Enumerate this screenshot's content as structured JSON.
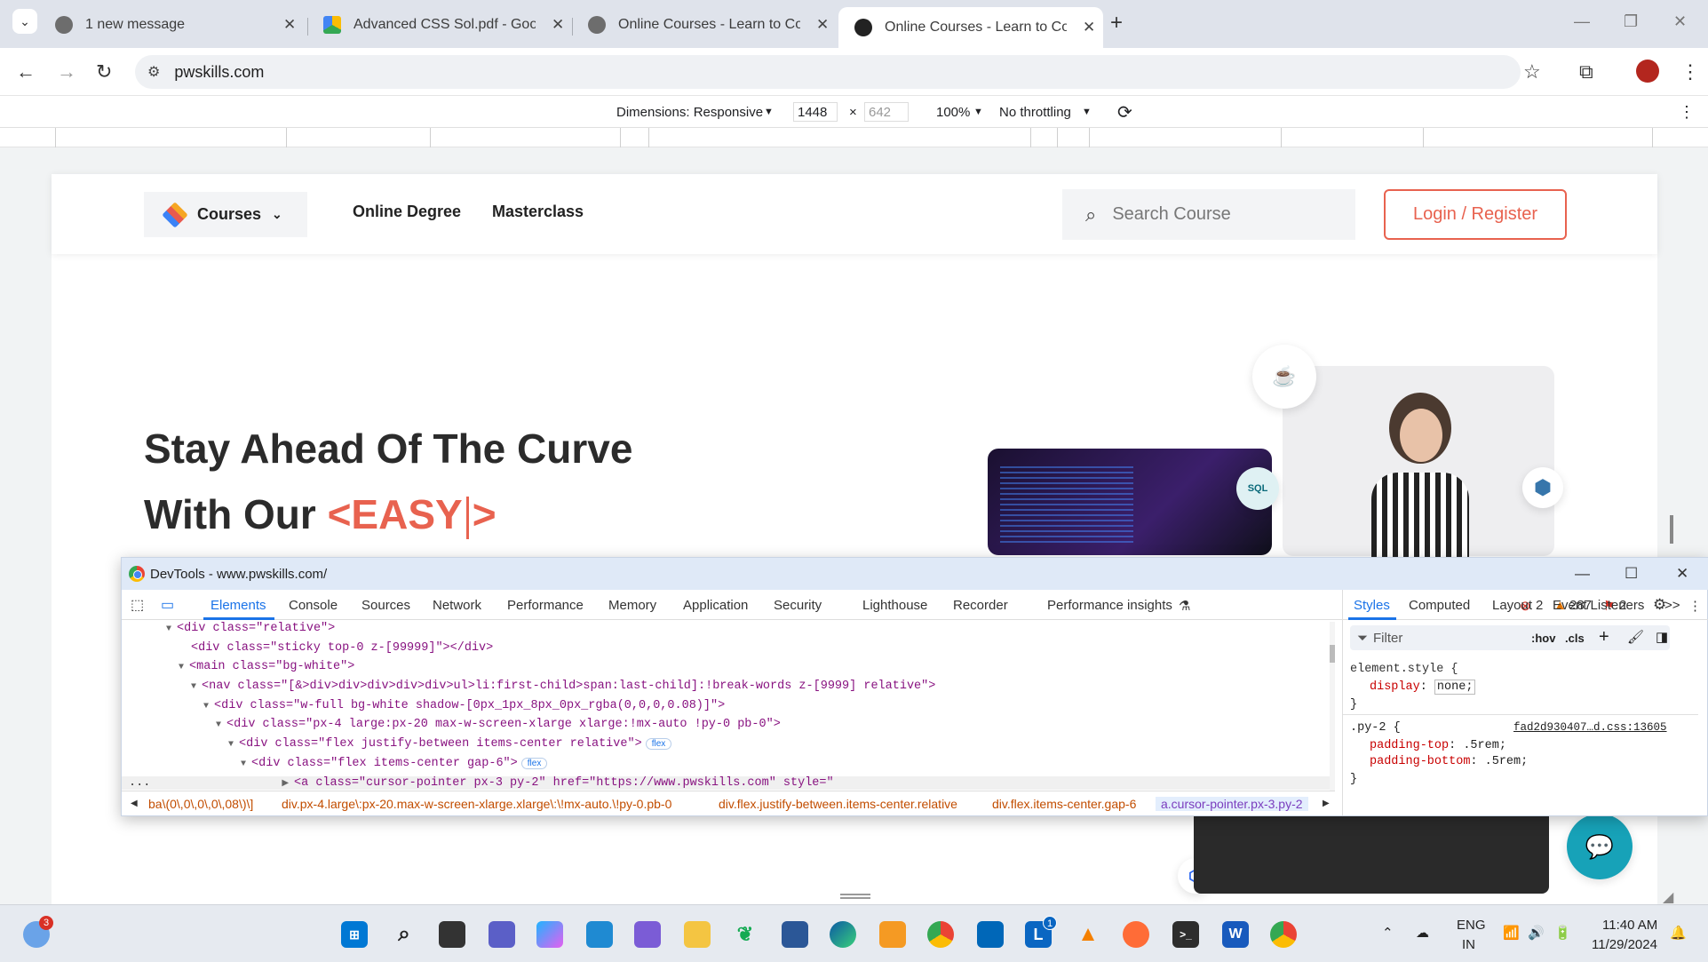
{
  "browser": {
    "tabs": [
      {
        "title": "1 new message"
      },
      {
        "title": "Advanced CSS Sol.pdf - Google"
      },
      {
        "title": "Online Courses - Learn to Code"
      },
      {
        "title": "Online Courses - Learn to Code"
      }
    ],
    "new_tab": "+",
    "url": "pwskills.com"
  },
  "device_toolbar": {
    "dimensions_label": "Dimensions: Responsive",
    "width": "1448",
    "times": "×",
    "height": "642",
    "zoom": "100%",
    "throttling": "No throttling"
  },
  "site": {
    "nav": {
      "courses": "Courses",
      "online_degree": "Online Degree",
      "masterclass": "Masterclass",
      "search_placeholder": "Search Course",
      "login": "Login / Register"
    },
    "hero": {
      "line1": "Stay Ahead Of The Curve",
      "line2_prefix": "With Our",
      "typed_open": "<EASY",
      "typed_close": ">"
    },
    "badges": {
      "sql": "SQL"
    }
  },
  "devtools": {
    "title": "DevTools - www.pwskills.com/",
    "tabs": [
      "Elements",
      "Console",
      "Sources",
      "Network",
      "Performance",
      "Memory",
      "Application",
      "Security",
      "Lighthouse",
      "Recorder",
      "Performance insights"
    ],
    "counts": {
      "errors": "2",
      "warnings": "287",
      "issues": "2"
    },
    "dom_lines": [
      {
        "tag": "<div class=\"relative\">"
      },
      {
        "tag": "<div class=\"sticky top-0 z-[99999]\"></div>"
      },
      {
        "tag": "<main class=\"bg-white\">"
      },
      {
        "tag": "<nav class=\"[&>div>div>div>div>div>ul>li:first-child>span:last-child]:!break-words z-[9999] relative\">"
      },
      {
        "tag": "<div class=\"w-full bg-white shadow-[0px_1px_8px_0px_rgba(0,0,0,0.08)]\">"
      },
      {
        "tag": "<div class=\"px-4 large:px-20 max-w-screen-xlarge xlarge:!mx-auto !py-0 pb-0\">"
      },
      {
        "tag": "<div class=\"flex justify-between items-center relative\">",
        "badge": "flex"
      },
      {
        "tag": "<div class=\"flex items-center gap-6\">",
        "badge": "flex"
      },
      {
        "tag": "<a class=\"cursor-pointer px-3 py-2\" href=\"https://www.pwskills.com\" style=\""
      }
    ],
    "ellipsis": "...",
    "breadcrumbs": [
      "ba\\(0\\,0\\,0\\,0\\,08\\)\\]",
      "div.px-4.large\\:px-20.max-w-screen-xlarge.xlarge\\:\\!mx-auto.\\!py-0.pb-0",
      "div.flex.justify-between.items-center.relative",
      "div.flex.items-center.gap-6",
      "a.cursor-pointer.px-3.py-2"
    ],
    "styles": {
      "tabs": [
        "Styles",
        "Computed",
        "Layout",
        "Event Listeners",
        ">>"
      ],
      "filter_placeholder": "Filter",
      "hov": ":hov",
      "cls": ".cls",
      "element_style": "element.style {",
      "display_prop": "display",
      "display_val": "none;",
      "close": "}",
      "rule_selector": ".py-2 {",
      "rule_source": "fad2d930407…d.css:13605",
      "pt_prop": "padding-top",
      "pt_val": ".5rem;",
      "pb_prop": "padding-bottom",
      "pb_val": ".5rem;"
    }
  },
  "taskbar": {
    "weather_badge": "3",
    "lang": "ENG",
    "region": "IN",
    "time": "11:40 AM",
    "date": "11/29/2024",
    "linkedin_badge": "1"
  },
  "colors": {
    "accent": "#e8624f",
    "devtools_blue": "#1a73e8"
  }
}
